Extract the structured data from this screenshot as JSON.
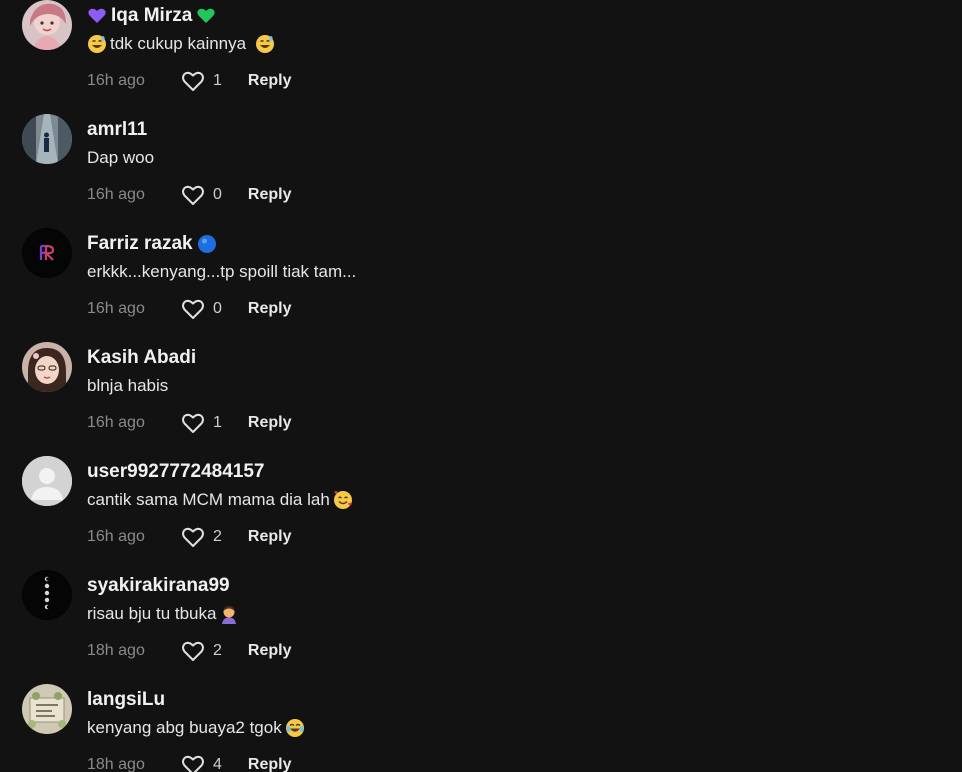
{
  "comments": [
    {
      "username": "Iqa Mirza",
      "text": "tdk cukup kainnya",
      "time": "16h ago",
      "likes": "1",
      "reply_label": "Reply",
      "avatar_icon": "profile-photo-pink",
      "name_prefix_icon": "purple-heart-emoji",
      "name_suffix_icon": "green-heart-emoji",
      "text_prefix_icon": "grinning-sweat-emoji",
      "text_suffix_icon": "grinning-sweat-emoji"
    },
    {
      "username": "amrl11",
      "text": "Dap woo",
      "time": "16h ago",
      "likes": "0",
      "reply_label": "Reply",
      "avatar_icon": "profile-photo-street"
    },
    {
      "username": "Farriz razak",
      "text": "erkkk...kenyang...tp spoill tiak tam...",
      "time": "16h ago",
      "likes": "0",
      "reply_label": "Reply",
      "avatar_icon": "profile-logo-fr",
      "name_suffix_icon": "blue-circle-emoji"
    },
    {
      "username": "Kasih Abadi",
      "text": "blnja habis",
      "time": "16h ago",
      "likes": "1",
      "reply_label": "Reply",
      "avatar_icon": "profile-photo-girl"
    },
    {
      "username": "user9927772484157",
      "text": "cantik sama MCM mama dia lah",
      "time": "16h ago",
      "likes": "2",
      "reply_label": "Reply",
      "avatar_icon": "default-avatar",
      "text_suffix_icon": "smiling-hearts-emoji"
    },
    {
      "username": "syakirakirana99",
      "text": "risau bju tu tbuka",
      "time": "18h ago",
      "likes": "2",
      "reply_label": "Reply",
      "avatar_icon": "profile-moon-phases",
      "text_suffix_icon": "facepalm-emoji"
    },
    {
      "username": "langsiLu",
      "text": "kenyang abg buaya2 tgok",
      "time": "18h ago",
      "likes": "4",
      "reply_label": "Reply",
      "avatar_icon": "profile-photo-flowers",
      "text_suffix_icon": "tears-of-joy-emoji"
    }
  ],
  "colors": {
    "background": "#121212",
    "username": "#f1f1f1",
    "text": "#e6e6e6",
    "meta": "#8a8a8a",
    "reply": "#e8e8e8"
  }
}
